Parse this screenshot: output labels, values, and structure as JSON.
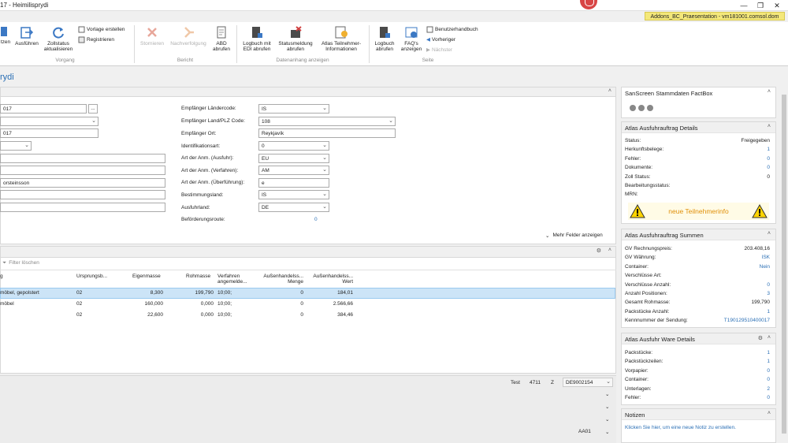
{
  "window": {
    "title": "17 - Heimilisprydi",
    "connection": "Addons_BC_Praesentation - vm181001.comsol.dom"
  },
  "ribbon": {
    "groups": {
      "vorgang": "Vorgang",
      "bericht": "Bericht",
      "datenanhang": "Datenanhang anzeigen",
      "seite": "Seite"
    },
    "buttons": {
      "setzen": "tzen",
      "ausfuehren": "Ausführen",
      "zollstatus": "Zollstatus aktualisieren",
      "vorlage": "Vorlage erstellen",
      "registrieren": "Registrieren",
      "stornieren": "Stornieren",
      "nachverfolgung": "Nachverfolgung",
      "abd": "ABD abrufen",
      "logbuch_edi": "Logbuch mit EDI abrufen",
      "statusmeldung": "Statusmeldung abrufen",
      "atlas_teilnehmer": "Atlas Teilnehmer-Informationen",
      "logbuch": "Logbuch abrufen",
      "faq": "FAQ's anzeigen",
      "handbuch": "Benutzerhandbuch",
      "vorheriger": "Vorheriger",
      "naechster": "Nächster"
    }
  },
  "page": {
    "title": "rydi"
  },
  "form": {
    "left": [
      "017",
      "",
      "017",
      "",
      "",
      "",
      "orsteinsson",
      "",
      ""
    ],
    "right_labels": [
      "Empfänger Ländercode:",
      "Empfänger Land/PLZ Code:",
      "Empfänger Ort:",
      "Identifikationsart:",
      "Art der Anm. (Ausfuhr):",
      "Art der Anm. (Verfahren):",
      "Art der Anm. (Überführung):",
      "Bestimmungsland:",
      "Ausfuhrland:",
      "Beförderungsroute:"
    ],
    "right_values": [
      "IS",
      "108",
      "Reykjavík",
      "0",
      "EU",
      "AM",
      "e",
      "IS",
      "DE",
      "0"
    ],
    "more_fields": "Mehr Felder anzeigen",
    "ellipsis": "..."
  },
  "lines": {
    "filter_placeholder": "Filter löschen",
    "headers": [
      "g",
      "Ursprungsb...",
      "Eigenmasse",
      "Rohmasse",
      "Verfahren angemelde...",
      "Außenhandelss... Menge",
      "Außenhandelss... Wert"
    ],
    "rows": [
      [
        "möbel, gepolstert",
        "02",
        "8,300",
        "199,790",
        "10;00;",
        "0",
        "184,01"
      ],
      [
        "möbel",
        "02",
        "160,000",
        "0,000",
        "10;00;",
        "0",
        "2.566,66"
      ],
      [
        "",
        "02",
        "22,600",
        "0,000",
        "10;00;",
        "0",
        "384,46"
      ]
    ]
  },
  "bottom": {
    "test": "Test",
    "num": "4711",
    "z": "Z",
    "code": "DE9002154",
    "aa": "AA01"
  },
  "factbox": {
    "stammdaten": {
      "title": "SanScreen Stammdaten FactBox"
    },
    "details": {
      "title": "Atlas Ausfuhrauftrag Details",
      "rows": [
        {
          "label": "Status:",
          "value": "Freigegeben"
        },
        {
          "label": "Herkunftsbelege:",
          "value": "1"
        },
        {
          "label": "Fehler:",
          "value": "0"
        },
        {
          "label": "Dokumente:",
          "value": "0"
        },
        {
          "label": "Zoll Status:",
          "value": "0"
        },
        {
          "label": "Bearbeitungsstatus:",
          "value": ""
        },
        {
          "label": "MRN:",
          "value": ""
        }
      ],
      "banner": "neue Teilnehmerinfo"
    },
    "summen": {
      "title": "Atlas Ausfuhrauftrag Summen",
      "rows": [
        {
          "label": "GV Rechnungspreis:",
          "value": "203.408,16"
        },
        {
          "label": "GV Währung:",
          "value": "ISK"
        },
        {
          "label": "Container:",
          "value": "Nein"
        },
        {
          "label": "Verschlüsse Art:",
          "value": ""
        },
        {
          "label": "Verschlüsse Anzahl:",
          "value": "0"
        },
        {
          "label": "Anzahl Positionen:",
          "value": "3"
        },
        {
          "label": "Gesamt Rohmasse:",
          "value": "199,790"
        },
        {
          "label": "Packstücke Anzahl:",
          "value": "1"
        },
        {
          "label": "Kennnummer der Sendung:",
          "value": "T190129510400017"
        }
      ]
    },
    "ware": {
      "title": "Atlas Ausfuhr Ware Details",
      "rows": [
        {
          "label": "Packstücke:",
          "value": "1"
        },
        {
          "label": "Packstückzeilen:",
          "value": "1"
        },
        {
          "label": "Vorpapier:",
          "value": "0"
        },
        {
          "label": "Container:",
          "value": "0"
        },
        {
          "label": "Unterlagen:",
          "value": "2"
        },
        {
          "label": "Fehler:",
          "value": "0"
        }
      ]
    },
    "notizen": {
      "title": "Notizen",
      "link": "Klicken Sie hier, um eine neue Notiz zu erstellen."
    }
  }
}
